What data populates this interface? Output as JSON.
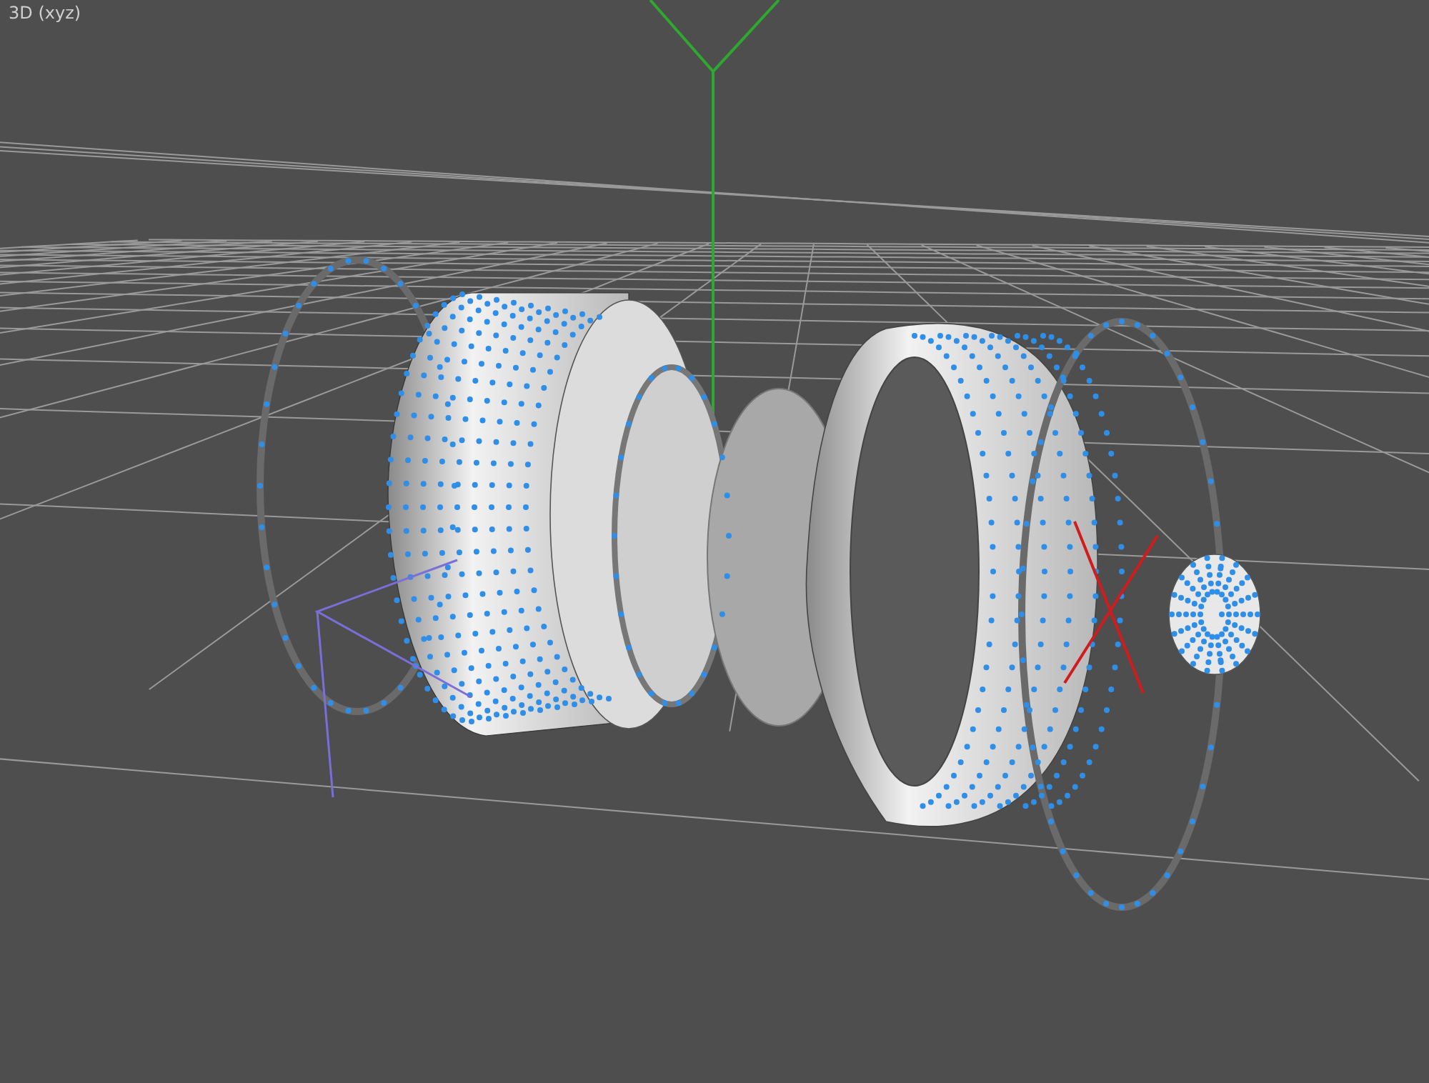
{
  "viewport": {
    "title": "3D (xyz)"
  }
}
